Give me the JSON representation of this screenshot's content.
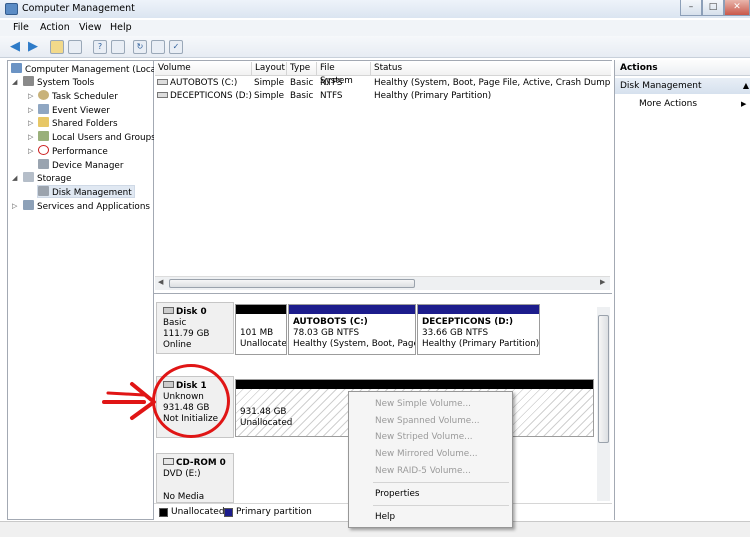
{
  "window": {
    "title": "Computer Management",
    "controls": [
      "–",
      "□",
      "✕"
    ]
  },
  "menu": [
    "File",
    "Action",
    "View",
    "Help"
  ],
  "tree": [
    {
      "label": "Computer Management (Local",
      "level": 0
    },
    {
      "label": "System Tools",
      "level": 1
    },
    {
      "label": "Task Scheduler",
      "level": 2
    },
    {
      "label": "Event Viewer",
      "level": 2
    },
    {
      "label": "Shared Folders",
      "level": 2
    },
    {
      "label": "Local Users and Groups",
      "level": 2
    },
    {
      "label": "Performance",
      "level": 2
    },
    {
      "label": "Device Manager",
      "level": 2
    },
    {
      "label": "Storage",
      "level": 1
    },
    {
      "label": "Disk Management",
      "level": 2,
      "selected": true
    },
    {
      "label": "Services and Applications",
      "level": 1
    }
  ],
  "volume_table": {
    "columns": [
      "Volume",
      "Layout",
      "Type",
      "File System",
      "Status"
    ],
    "rows": [
      [
        "AUTOBOTS (C:)",
        "Simple",
        "Basic",
        "NTFS",
        "Healthy (System, Boot, Page File, Active, Crash Dump, Prin"
      ],
      [
        "DECEPTICONS (D:)",
        "Simple",
        "Basic",
        "NTFS",
        "Healthy (Primary Partition)"
      ]
    ]
  },
  "disks": {
    "disk0": {
      "name": "Disk 0",
      "type": "Basic",
      "size": "111.79 GB",
      "status": "Online",
      "partitions": [
        {
          "line1": "",
          "line2": "101 MB",
          "line3": "Unallocate"
        },
        {
          "line1": "AUTOBOTS  (C:)",
          "line2": "78.03 GB NTFS",
          "line3": "Healthy (System, Boot, Page I"
        },
        {
          "line1": "DECEPTICONS  (D:)",
          "line2": "33.66 GB NTFS",
          "line3": "Healthy (Primary Partition)"
        }
      ]
    },
    "disk1": {
      "name": "Disk 1",
      "type": "Unknown",
      "size": "931.48 GB",
      "status": "Not Initialize",
      "partition": {
        "size": "931.48 GB",
        "label": "Unallocated"
      }
    },
    "cdrom0": {
      "name": "CD-ROM 0",
      "type": "DVD (E:)",
      "status": "No Media"
    }
  },
  "legend": {
    "unallocated": "Unallocated",
    "primary": "Primary partition"
  },
  "actions": {
    "header": "Actions",
    "section": "Disk Management",
    "item": "More Actions"
  },
  "context_menu": {
    "disabled": [
      "New Simple Volume...",
      "New Spanned Volume...",
      "New Striped Volume...",
      "New Mirrored Volume...",
      "New RAID-5 Volume..."
    ],
    "properties": "Properties",
    "help": "Help"
  },
  "colors": {
    "unallocated": "#000000",
    "primary": "#1c1c8c",
    "annotation": "#e01515"
  }
}
